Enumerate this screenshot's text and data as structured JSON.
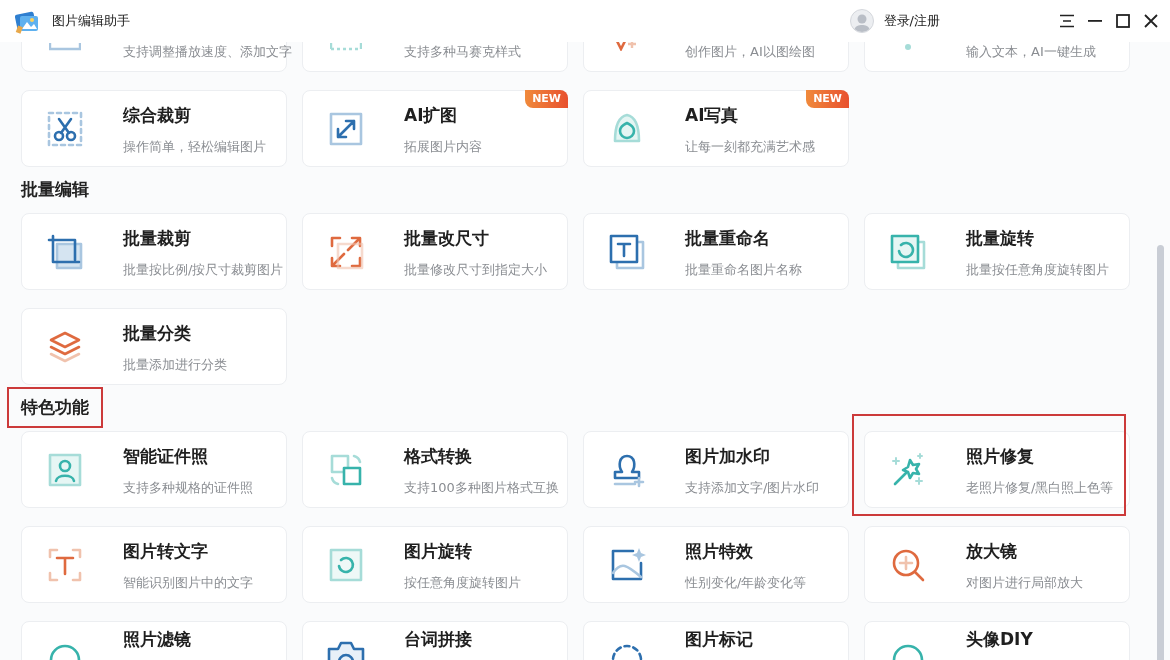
{
  "window": {
    "title": "图片编辑助手"
  },
  "account": {
    "label": "登录/注册"
  },
  "sections": [
    {
      "cards": [
        {
          "kind": "video",
          "description": "支持调整播放速度、添加文字",
          "highlighted": false
        },
        {
          "kind": "mosaic",
          "description": "支持多种马赛克样式",
          "highlighted": false
        },
        {
          "kind": "ai-draw",
          "description": "创作图片，AI以图绘图",
          "highlighted": false
        },
        {
          "kind": "ai-text",
          "description": "输入文本，AI一键生成",
          "highlighted": false
        },
        {
          "kind": "scissors",
          "title": "综合裁剪",
          "description": "操作简单，轻松编辑图片",
          "highlighted": false
        },
        {
          "kind": "expand",
          "title": "AI扩图",
          "description": "拓展图片内容",
          "badge": "NEW",
          "highlighted": false
        },
        {
          "kind": "portrait",
          "title": "AI写真",
          "description": "让每一刻都充满艺术感",
          "badge": "NEW",
          "highlighted": false
        }
      ]
    },
    {
      "heading": "批量编辑",
      "highlighted": false,
      "cards": [
        {
          "kind": "batch-crop",
          "title": "批量裁剪",
          "description": "批量按比例/按尺寸裁剪图片",
          "highlighted": false
        },
        {
          "kind": "resize",
          "title": "批量改尺寸",
          "description": "批量修改尺寸到指定大小",
          "highlighted": false
        },
        {
          "kind": "rename",
          "title": "批量重命名",
          "description": "批量重命名图片名称",
          "highlighted": false
        },
        {
          "kind": "batch-rotate",
          "title": "批量旋转",
          "description": "批量按任意角度旋转图片",
          "highlighted": false
        },
        {
          "kind": "layers",
          "title": "批量分类",
          "description": "批量添加进行分类",
          "highlighted": false
        }
      ]
    },
    {
      "heading": "特色功能",
      "highlighted": true,
      "cards": [
        {
          "kind": "id-photo",
          "title": "智能证件照",
          "description": "支持多种规格的证件照",
          "highlighted": false
        },
        {
          "kind": "format",
          "title": "格式转换",
          "description": "支持100多种图片格式互换",
          "highlighted": false
        },
        {
          "kind": "stamp",
          "title": "图片加水印",
          "description": "支持添加文字/图片水印",
          "highlighted": false
        },
        {
          "kind": "wand",
          "title": "照片修复",
          "description": "老照片修复/黑白照上色等",
          "highlighted": true
        },
        {
          "kind": "ocr",
          "title": "图片转文字",
          "description": "智能识别图片中的文字",
          "highlighted": false
        },
        {
          "kind": "rotate",
          "title": "图片旋转",
          "description": "按任意角度旋转图片",
          "highlighted": false
        },
        {
          "kind": "effect",
          "title": "照片特效",
          "description": "性别变化/年龄变化等",
          "highlighted": false
        },
        {
          "kind": "magnifier",
          "title": "放大镜",
          "description": "对图片进行局部放大",
          "highlighted": false
        },
        {
          "kind": "filter",
          "title": "照片滤镜",
          "highlighted": false
        },
        {
          "kind": "subtitle",
          "title": "台词拼接",
          "highlighted": false
        },
        {
          "kind": "mark",
          "title": "图片标记",
          "highlighted": false
        },
        {
          "kind": "avatar",
          "title": "头像DIY",
          "highlighted": false
        }
      ]
    }
  ]
}
